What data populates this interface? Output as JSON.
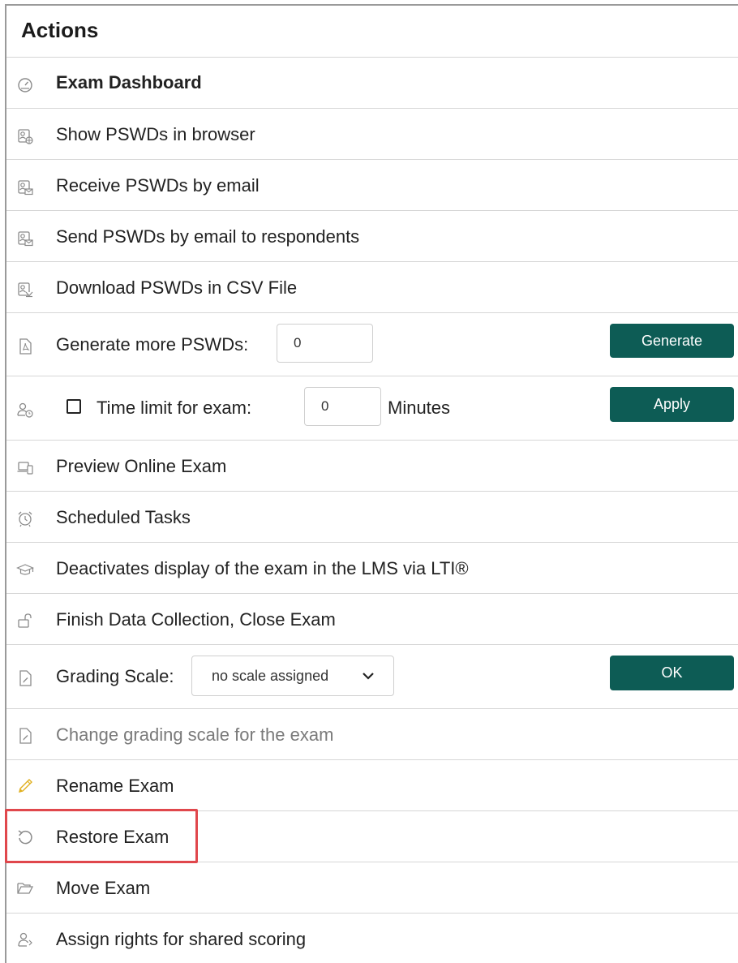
{
  "panel": {
    "title": "Actions"
  },
  "colors": {
    "button_bg": "#0d5c55",
    "highlight": "#e0474c",
    "icon_gray": "#8a8a8a",
    "pencil": "#e0b020"
  },
  "rows": {
    "dashboard": {
      "label": "Exam Dashboard",
      "icon": "dashboard-gauge-icon"
    },
    "show_pswds": {
      "label": "Show PSWDs in browser",
      "icon": "contact-globe-icon"
    },
    "receive_pswds": {
      "label": "Receive PSWDs by email",
      "icon": "contact-mail-icon"
    },
    "send_pswds": {
      "label": "Send PSWDs by email to respondents",
      "icon": "contact-mail-icon"
    },
    "download_pswds": {
      "label": "Download PSWDs in CSV File",
      "icon": "contact-download-icon"
    },
    "generate": {
      "label": "Generate more PSWDs:",
      "value": "0",
      "button": "Generate",
      "icon": "pdf-document-icon"
    },
    "time_limit": {
      "label": "Time limit for exam:",
      "value": "0",
      "unit": "Minutes",
      "button": "Apply",
      "checked": false,
      "icon": "person-clock-icon"
    },
    "preview": {
      "label": "Preview Online Exam",
      "icon": "devices-icon"
    },
    "scheduled": {
      "label": "Scheduled Tasks",
      "icon": "alarm-clock-icon"
    },
    "lti": {
      "label": "Deactivates display of the exam in the LMS via LTI®",
      "icon": "graduation-cap-icon"
    },
    "finish": {
      "label": "Finish Data Collection, Close Exam",
      "icon": "unlock-icon"
    },
    "grading": {
      "label": "Grading Scale:",
      "selected": "no scale assigned",
      "button": "OK",
      "icon": "document-edit-icon"
    },
    "change_grading": {
      "label": "Change grading scale for the exam",
      "icon": "document-edit-icon"
    },
    "rename": {
      "label": "Rename Exam",
      "icon": "pencil-icon"
    },
    "restore": {
      "label": "Restore Exam",
      "icon": "restore-arrow-icon"
    },
    "move": {
      "label": "Move Exam",
      "icon": "folder-open-icon"
    },
    "assign": {
      "label": "Assign rights for shared scoring",
      "icon": "person-share-icon"
    }
  }
}
